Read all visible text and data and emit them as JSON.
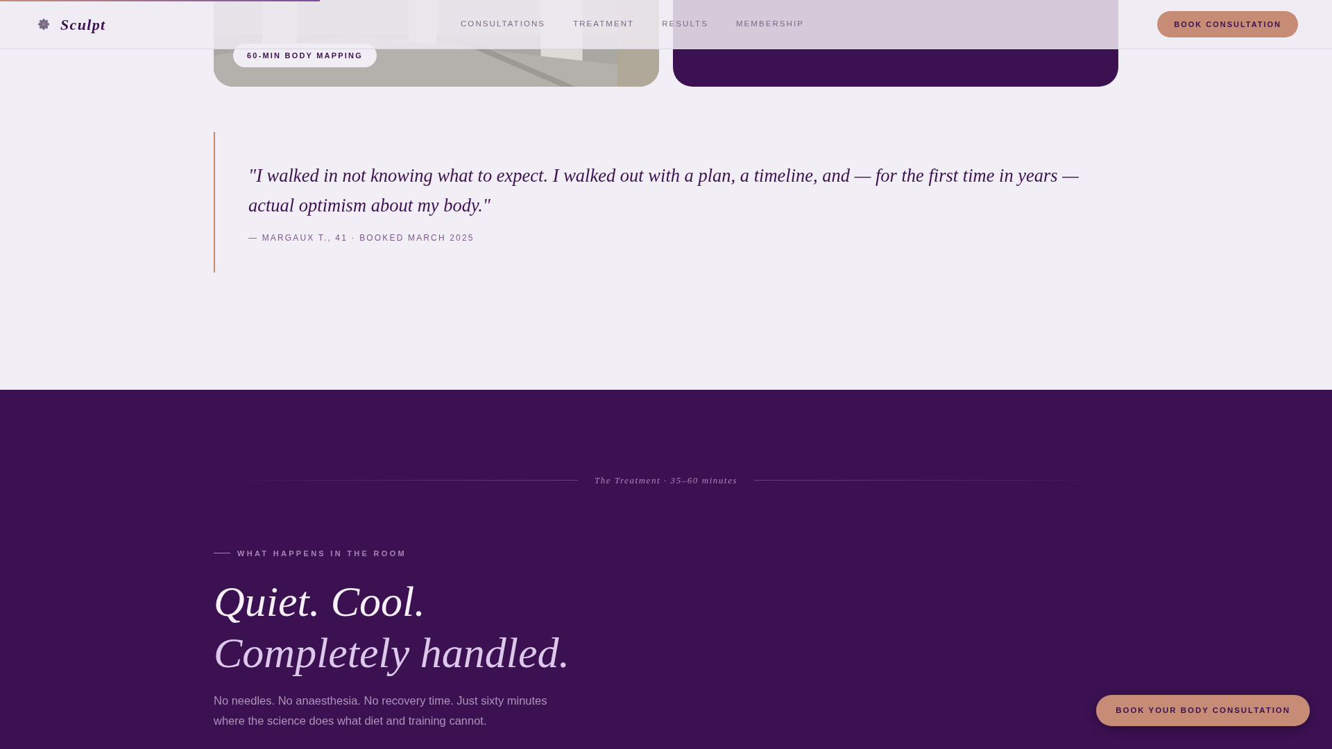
{
  "progress": {
    "level": 0.24
  },
  "header": {
    "brand": "Sculpt",
    "nav": [
      {
        "label": "CONSULTATIONS"
      },
      {
        "label": "TREATMENT"
      },
      {
        "label": "RESULTS"
      },
      {
        "label": "MEMBERSHIP"
      }
    ],
    "cta": "BOOK CONSULTATION"
  },
  "cards": [
    {
      "kind": "picture",
      "badge": "60-MIN BODY MAPPING"
    },
    {
      "kind": "plain"
    }
  ],
  "testimonial": {
    "quote": "\"I walked in not knowing what to expect. I walked out with a plan, a timeline, and — for the first time in years — actual optimism about my body.\"",
    "attribution": "— MARGAUX T., 41 · BOOKED MARCH 2025"
  },
  "treatment": {
    "divider_label": "The Treatment · 35–60 minutes",
    "eyebrow": "WHAT HAPPENS IN THE ROOM",
    "heading_line_1": "Quiet. Cool.",
    "heading_line_2": "Completely handled.",
    "body": "No needles. No anaesthesia. No recovery time. Just sixty minutes where the science does what diet and training cannot."
  },
  "floating_cta": "BOOK YOUR BODY CONSULTATION"
}
